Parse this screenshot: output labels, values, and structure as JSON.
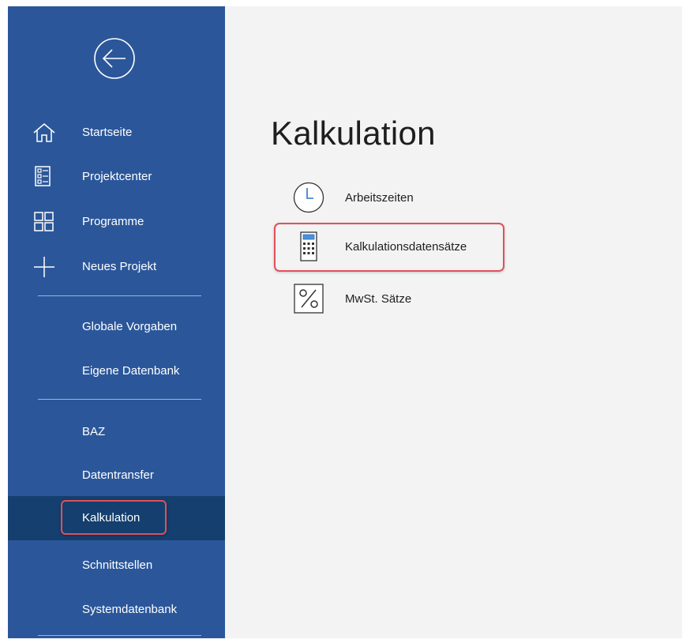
{
  "app": {
    "sidebar_color": "#2b579a",
    "sidebar_active_color": "#143f6e",
    "highlight_color": "#e0515a"
  },
  "sidebar": {
    "back_icon": "back-arrow-circle-icon",
    "items": [
      {
        "id": "startseite",
        "label": "Startseite",
        "icon": "home-icon"
      },
      {
        "id": "projektcenter",
        "label": "Projektcenter",
        "icon": "list-document-icon"
      },
      {
        "id": "programme",
        "label": "Programme",
        "icon": "grid-icon"
      },
      {
        "id": "neues-projekt",
        "label": "Neues Projekt",
        "icon": "plus-icon"
      },
      {
        "id": "globale-vorgaben",
        "label": "Globale Vorgaben"
      },
      {
        "id": "eigene-datenbank",
        "label": "Eigene Datenbank"
      },
      {
        "id": "baz",
        "label": "BAZ"
      },
      {
        "id": "datentransfer",
        "label": "Datentransfer"
      },
      {
        "id": "kalkulation",
        "label": "Kalkulation",
        "active": true
      },
      {
        "id": "schnittstellen",
        "label": "Schnittstellen"
      },
      {
        "id": "systemdatenbank",
        "label": "Systemdatenbank"
      }
    ]
  },
  "main": {
    "title": "Kalkulation",
    "items": [
      {
        "id": "arbeitszeiten",
        "label": "Arbeitszeiten",
        "icon": "clock-icon"
      },
      {
        "id": "kalkulationsdatensaetze",
        "label": "Kalkulationsdatensätze",
        "icon": "calculator-icon",
        "highlighted": true
      },
      {
        "id": "mwst-saetze",
        "label": "MwSt. Sätze",
        "icon": "percent-icon"
      }
    ]
  }
}
